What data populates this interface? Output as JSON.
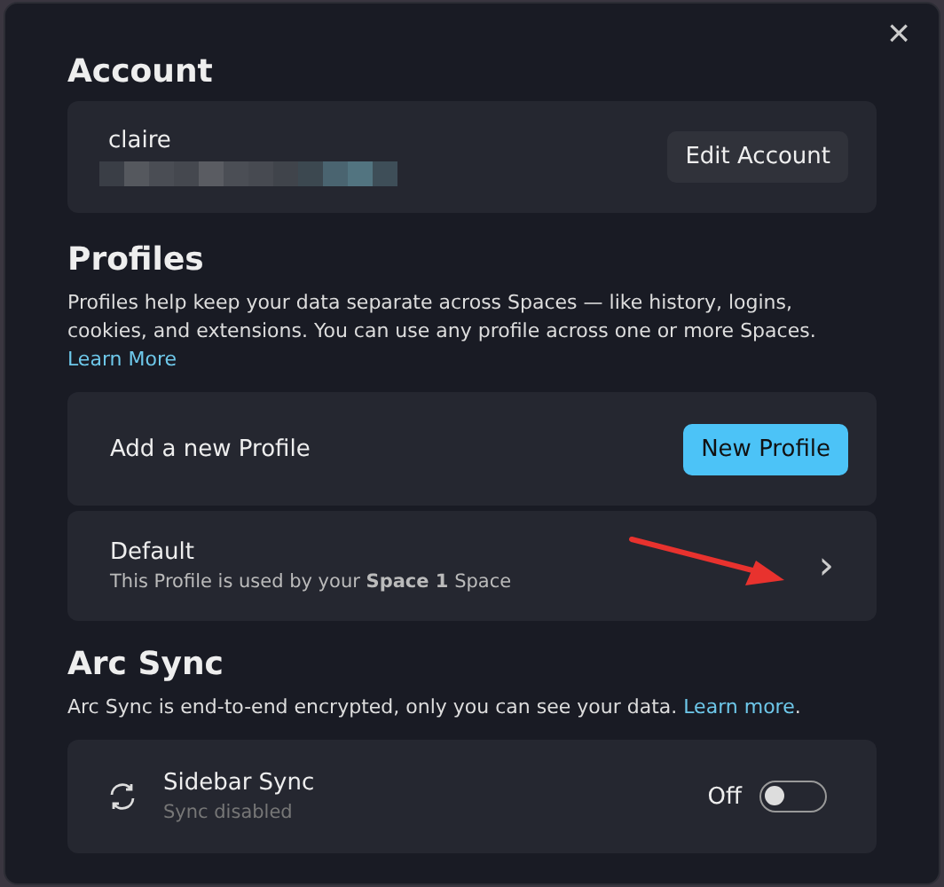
{
  "close": "×",
  "account": {
    "title": "Account",
    "name": "claire",
    "button": "Edit Account"
  },
  "profiles": {
    "title": "Profiles",
    "description": "Profiles help keep your data separate across Spaces — like history, logins, cookies, and extensions. You can use any profile across one or more Spaces.",
    "link": "Learn More",
    "rows": [
      {
        "kind": "action",
        "label": "Add a new Profile",
        "button": "New Profile"
      },
      {
        "kind": "nav",
        "label": "Default",
        "subtitle": "This Profile is used by your **Space 1** Space",
        "chevron": "›"
      }
    ]
  },
  "sync": {
    "title": "Arc Sync",
    "description": "Arc Sync is end-to-end encrypted, only you can see your data.",
    "link": "Learn more",
    "after_link": ".",
    "rows": [
      {
        "label": "Sidebar Sync",
        "subtitle": "Sync disabled",
        "state_text": "Off",
        "on": false
      }
    ]
  }
}
